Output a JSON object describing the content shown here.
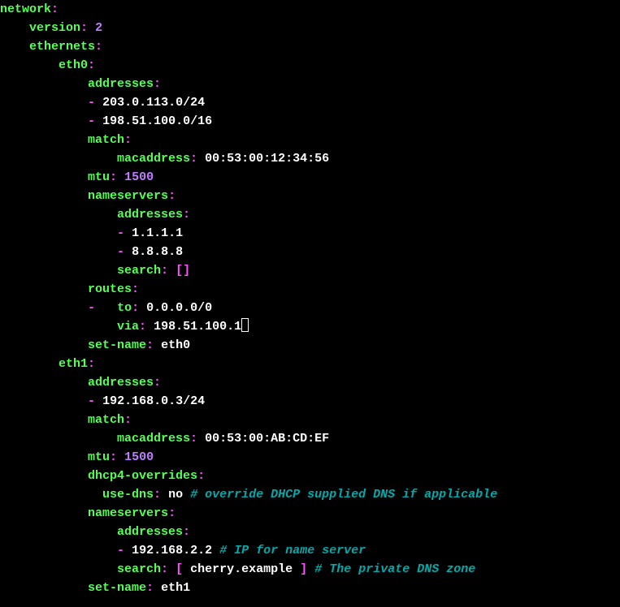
{
  "k": {
    "network": "network",
    "version": "version",
    "ethernets": "ethernets",
    "eth0": "eth0",
    "eth1": "eth1",
    "addresses": "addresses",
    "match": "match",
    "macaddress": "macaddress",
    "mtu": "mtu",
    "nameservers": "nameservers",
    "search": "search",
    "routes": "routes",
    "to": "to",
    "via": "via",
    "setname": "set-name",
    "dhcp4ov": "dhcp4-overrides",
    "usedns": "use-dns"
  },
  "v": {
    "version": "2",
    "eth0_addr1": "203.0.113.0/24",
    "eth0_addr2": "198.51.100.0/16",
    "eth0_mac": "00:53:00:12:34:56",
    "eth0_mtu": "1500",
    "eth0_ns1": "1.1.1.1",
    "eth0_ns2": "8.8.8.8",
    "eth0_route_to": "0.0.0.0/0",
    "eth0_route_via": "198.51.100.1",
    "eth0_setname": "eth0",
    "eth1_addr1": "192.168.0.3/24",
    "eth1_mac": "00:53:00:AB:CD:EF",
    "eth1_mtu": "1500",
    "eth1_usedns": "no",
    "eth1_ns1": "192.168.2.2",
    "eth1_search": "cherry.example",
    "eth1_setname": "eth1"
  },
  "c": {
    "dns_override": "# override DHCP supplied DNS if applicable",
    "ip_nameserver": "# IP for name server",
    "private_zone": "# The private DNS zone"
  },
  "p": {
    "colon": ":",
    "dash": "-",
    "lbr": "[",
    "rbr": "]",
    "empty_arr": "[]"
  }
}
